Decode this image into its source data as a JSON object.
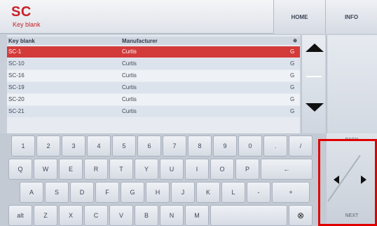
{
  "header": {
    "title": "SC",
    "subtitle": "Key blank",
    "home_label": "HOME",
    "info_label": "INFO"
  },
  "table": {
    "columns": [
      "Key blank",
      "Manufacturer",
      "⊕"
    ],
    "rows": [
      {
        "key": "SC-1",
        "manufacturer": "Curtis",
        "flag": "G",
        "selected": true
      },
      {
        "key": "SC-10",
        "manufacturer": "Curtis",
        "flag": "G"
      },
      {
        "key": "SC-16",
        "manufacturer": "Curtis",
        "flag": "G"
      },
      {
        "key": "SC-19",
        "manufacturer": "Curtis",
        "flag": "G"
      },
      {
        "key": "SC-20",
        "manufacturer": "Curtis",
        "flag": "G"
      },
      {
        "key": "SC-21",
        "manufacturer": "Curtis",
        "flag": "G"
      }
    ]
  },
  "keyboard": {
    "row1": [
      "1",
      "2",
      "3",
      "4",
      "5",
      "6",
      "7",
      "8",
      "9",
      "0",
      ".",
      "/"
    ],
    "row2": [
      "Q",
      "W",
      "E",
      "R",
      "T",
      "Y",
      "U",
      "I",
      "O",
      "P",
      "←"
    ],
    "row3": [
      "A",
      "S",
      "D",
      "F",
      "G",
      "H",
      "J",
      "K",
      "L",
      "-",
      "+"
    ],
    "row4": [
      "alt",
      "Z",
      "X",
      "C",
      "V",
      "B",
      "N",
      "M",
      "",
      "⊗"
    ]
  },
  "nav": {
    "back_label": "BACK",
    "next_label": "NEXT"
  },
  "colors": {
    "accent": "#c8212a",
    "highlight": "#e00000"
  }
}
